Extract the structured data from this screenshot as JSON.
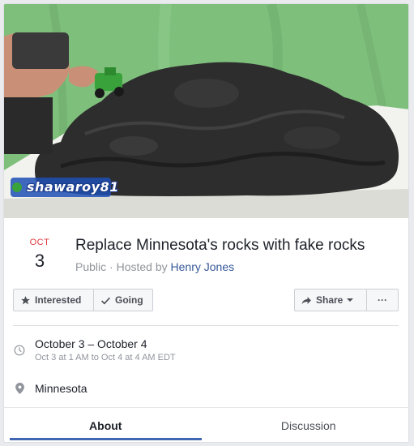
{
  "cover": {
    "watermark": "shawaroy81"
  },
  "event": {
    "month": "OCT",
    "day": "3",
    "title": "Replace Minnesota's rocks with fake rocks",
    "privacy": "Public",
    "hosted_by_label": "Hosted by",
    "host": "Henry Jones"
  },
  "actions": {
    "interested": "Interested",
    "going": "Going",
    "share": "Share",
    "more": "···"
  },
  "details": {
    "time_main": "October 3 – October 4",
    "time_sub": "Oct 3 at 1 AM to Oct 4 at 4 AM EDT",
    "location": "Minnesota"
  },
  "tabs": [
    {
      "label": "About",
      "active": true
    },
    {
      "label": "Discussion",
      "active": false
    }
  ],
  "colors": {
    "accent": "#4267b2",
    "month": "#e0393e",
    "link": "#365899"
  }
}
